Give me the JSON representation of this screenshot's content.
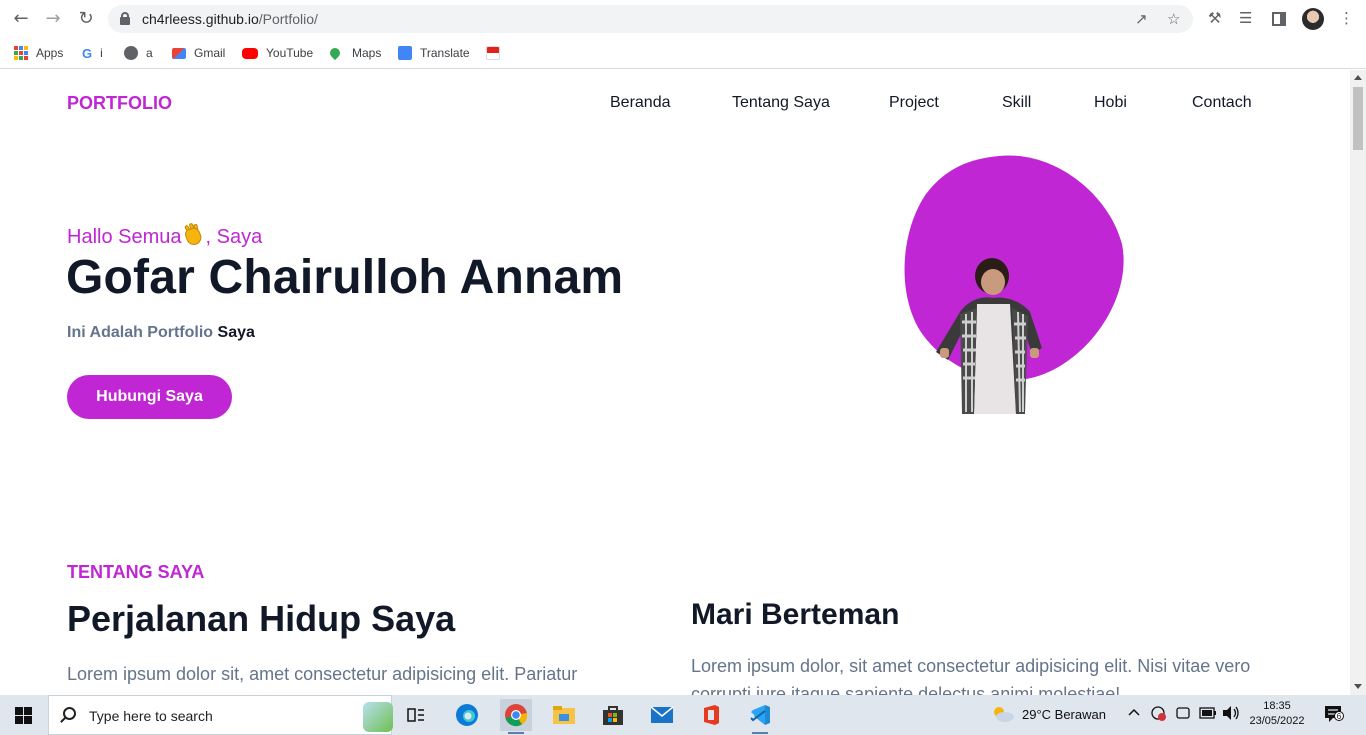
{
  "browser": {
    "url_host": "ch4rleess.github.io",
    "url_path": "/Portfolio/",
    "bookmarks": [
      {
        "label": "Apps",
        "icon": "apps-grid-icon"
      },
      {
        "label": "i",
        "icon": "google-icon"
      },
      {
        "label": "a",
        "icon": "globe-icon"
      },
      {
        "label": "Gmail",
        "icon": "gmail-icon"
      },
      {
        "label": "YouTube",
        "icon": "youtube-icon"
      },
      {
        "label": "Maps",
        "icon": "maps-icon"
      },
      {
        "label": "Translate",
        "icon": "translate-icon"
      }
    ]
  },
  "site": {
    "brand": "PORTFOLIO",
    "nav": [
      "Beranda",
      "Tentang Saya",
      "Project",
      "Skill",
      "Hobi",
      "Contach"
    ],
    "accent": "#c026d3",
    "hero": {
      "greeting_prefix": "Hallo Semua",
      "greeting_suffix": ", Saya",
      "name": "Gofar Chairulloh Annam",
      "subtitle_prefix": "Ini Adalah Portfolio ",
      "subtitle_bold": "Saya",
      "cta": "Hubungi Saya"
    },
    "about": {
      "label": "TENTANG SAYA",
      "title": "Perjalanan Hidup Saya",
      "text": "Lorem ipsum dolor sit, amet consectetur adipisicing elit. Pariatur",
      "text_cont": "",
      "col2_title": "Mari Berteman",
      "col2_text": "Lorem ipsum dolor, sit amet consectetur adipisicing elit. Nisi vitae vero",
      "col2_text_cont": "corrupti iure itaque sapiente delectus animi molestiae!"
    }
  },
  "taskbar": {
    "search_placeholder": "Type here to search",
    "weather": "29°C  Berawan",
    "time": "18:35",
    "date": "23/05/2022",
    "notifications": "6"
  }
}
